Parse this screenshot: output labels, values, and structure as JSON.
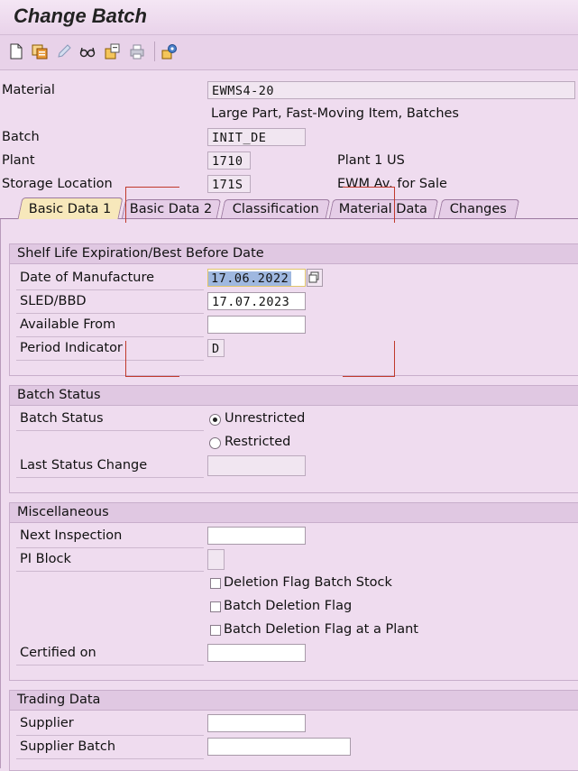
{
  "window": {
    "title": "Change Batch"
  },
  "toolbar": {
    "icons": [
      "new-document-icon",
      "display-other-icon",
      "edit-pencil-icon",
      "glasses-icon",
      "where-used-icon",
      "print-icon",
      "configure-icon"
    ]
  },
  "header": {
    "material": {
      "label": "Material",
      "value": "EWMS4-20",
      "description": "Large Part, Fast-Moving Item, Batches"
    },
    "batch": {
      "label": "Batch",
      "value": "INIT_DE"
    },
    "plant": {
      "label": "Plant",
      "value": "1710",
      "description": "Plant 1 US"
    },
    "storage_location": {
      "label": "Storage Location",
      "value": "171S",
      "description": "EWM Av. for Sale"
    }
  },
  "tabs": [
    {
      "label": "Basic Data 1",
      "active": true
    },
    {
      "label": "Basic Data 2",
      "active": false
    },
    {
      "label": "Classification",
      "active": false
    },
    {
      "label": "Material Data",
      "active": false
    },
    {
      "label": "Changes",
      "active": false
    }
  ],
  "shelf_life": {
    "title": "Shelf Life Expiration/Best Before Date",
    "date_of_manufacture": {
      "label": "Date of Manufacture",
      "value": "17.06.2022"
    },
    "sled_bbd": {
      "label": "SLED/BBD",
      "value": "17.07.2023"
    },
    "available_from": {
      "label": "Available From",
      "value": ""
    },
    "period_indicator": {
      "label": "Period Indicator",
      "value": "D"
    }
  },
  "batch_status": {
    "title": "Batch Status",
    "status_label": "Batch Status",
    "unrestricted_label": "Unrestricted",
    "restricted_label": "Restricted",
    "selected": "Unrestricted",
    "last_status_change": {
      "label": "Last Status Change",
      "value": ""
    }
  },
  "misc": {
    "title": "Miscellaneous",
    "next_inspection": {
      "label": "Next Inspection",
      "value": ""
    },
    "pi_block": {
      "label": "PI Block",
      "value": ""
    },
    "deletion_flag_batch_stock": {
      "label": "Deletion Flag Batch Stock",
      "checked": false
    },
    "batch_deletion_flag": {
      "label": "Batch Deletion Flag",
      "checked": false
    },
    "batch_deletion_flag_plant": {
      "label": "Batch Deletion Flag at a Plant",
      "checked": false
    },
    "certified_on": {
      "label": "Certified on",
      "value": ""
    }
  },
  "trading": {
    "title": "Trading Data",
    "supplier": {
      "label": "Supplier",
      "value": ""
    },
    "supplier_batch": {
      "label": "Supplier Batch",
      "value": ""
    }
  },
  "colors": {
    "background": "#efdcef",
    "active_tab": "#f7e8bb",
    "selected_field": "#9fb8e0",
    "annotation_red": "#c0392b"
  }
}
